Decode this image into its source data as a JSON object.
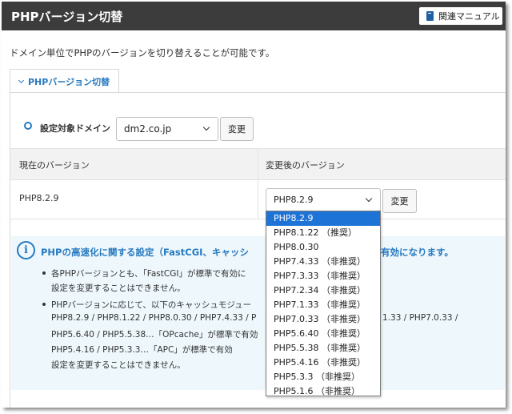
{
  "header": {
    "title": "PHPバージョン切替",
    "manual_button": "関連マニュアル"
  },
  "description": "ドメイン単位でPHPのバージョンを切り替えることが可能です。",
  "tab": {
    "label": "PHPバージョン切替"
  },
  "domain_row": {
    "label": "設定対象ドメイン",
    "selected": "dm2.co.jp",
    "change_button": "変更"
  },
  "table": {
    "headers": [
      "現在のバージョン",
      "変更後のバージョン"
    ],
    "current_version": "PHP8.2.9",
    "selected_version": "PHP8.2.9",
    "change_button": "変更"
  },
  "version_options": [
    "PHP8.2.9",
    "PHP8.1.22 （推奨）",
    "PHP8.0.30",
    "PHP7.4.33 （非推奨）",
    "PHP7.3.33 （非推奨）",
    "PHP7.2.34 （非推奨）",
    "PHP7.1.33 （非推奨）",
    "PHP7.0.33 （非推奨）",
    "PHP5.6.40 （非推奨）",
    "PHP5.5.38 （非推奨）",
    "PHP5.4.16 （非推奨）",
    "PHP5.3.3 （非推奨）",
    "PHP5.1.6 （非推奨）"
  ],
  "info": {
    "title": "PHPの高速化に関する設定（FastCGI、キャッシ",
    "title_tail": "有効になります。",
    "bullets": [
      {
        "lines": [
          "各PHPバージョンとも、「FastCGI」が標準で有効に",
          "設定を変更することはできません。"
        ]
      },
      {
        "lines": [
          "PHPバージョンに応じて、以下のキャッシュモジュー",
          "PHP8.2.9 / PHP8.1.22 / PHP8.0.30 / PHP7.4.33 / P",
          "PHP5.6.40 / PHP5.5.38…「OPcache」が標準で有効",
          "PHP5.4.16 / PHP5.3.3…「APC」が標準で有効",
          "設定を変更することはできません。"
        ],
        "right_fragment": "1.33 / PHP7.0.33 /"
      }
    ]
  },
  "colors": {
    "header_bg": "#3c3c3c",
    "accent": "#2779c0",
    "info_bg": "#eef8fc",
    "option_selected": "#1e73d6"
  }
}
